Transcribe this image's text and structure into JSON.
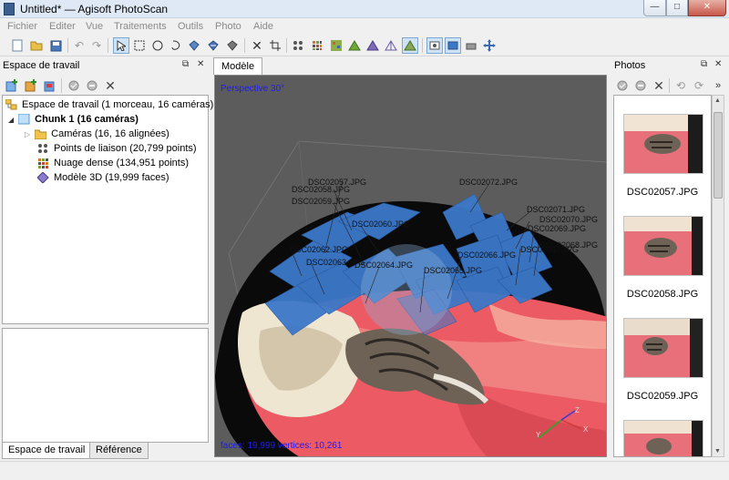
{
  "window": {
    "title": "Untitled* — Agisoft PhotoScan",
    "buttons": {
      "minimize": "—",
      "maximize": "□",
      "close": "✕"
    }
  },
  "menu": [
    "Fichier",
    "Editer",
    "Vue",
    "Traitements",
    "Outils",
    "Photo",
    "Aide"
  ],
  "toolbar_icons": [
    "new-icon",
    "open-icon",
    "save-icon",
    "undo-icon",
    "redo-icon",
    "navigation-icon",
    "rect-select-icon",
    "circle-select-icon",
    "free-select-icon",
    "rotate-model-icon",
    "move-model-icon",
    "resize-model-icon",
    "delete-icon",
    "crop-icon",
    "show-cameras-icon",
    "show-points-icon",
    "show-dense-icon",
    "show-shaded-icon",
    "show-solid-icon",
    "show-wireframe-icon",
    "show-textured-icon",
    "show-thumbnails-icon",
    "show-aligned-icon",
    "show-region-icon",
    "reset-view-icon"
  ],
  "workspace": {
    "title": "Espace de travail",
    "tree": {
      "root": "Espace de travail (1 morceau, 16 caméras)",
      "chunk": "Chunk 1 (16 caméras)",
      "items": [
        "Caméras (16, 16 alignées)",
        "Points de liaison (20,799 points)",
        "Nuage dense (134,951 points)",
        "Modèle 3D (19,999 faces)"
      ]
    },
    "bottom_tabs": [
      "Espace de travail",
      "Référence"
    ]
  },
  "model": {
    "tab": "Modèle",
    "perspective": "Perspective 30°",
    "status": "faces: 19,999 vertices: 10,261",
    "axes": {
      "x": "X",
      "y": "Y",
      "z": "Z"
    },
    "camera_labels": [
      "DSC02057.JPG",
      "DSC02058.JPG",
      "DSC02059.JPG",
      "DSC02072.JPG",
      "DSC02071.JPG",
      "DSC02070.JPG",
      "DSC02069.JPG",
      "DSC02068.JPG",
      "DSC02067.JPG",
      "DSC02062.JPG",
      "DSC02063.JPG",
      "DSC02064.JPG",
      "DSC02065.JPG",
      "DSC02066.JPG",
      "DSC02060.JPG"
    ]
  },
  "photos": {
    "title": "Photos",
    "more": "»",
    "items": [
      "DSC02057.JPG",
      "DSC02058.JPG",
      "DSC02059.JPG"
    ]
  },
  "colors": {
    "accent": "#1a1aff",
    "camera_plane": "#3c78c8",
    "viewport_bg": "#5c5c5c",
    "blanket": "#ec5a63"
  }
}
